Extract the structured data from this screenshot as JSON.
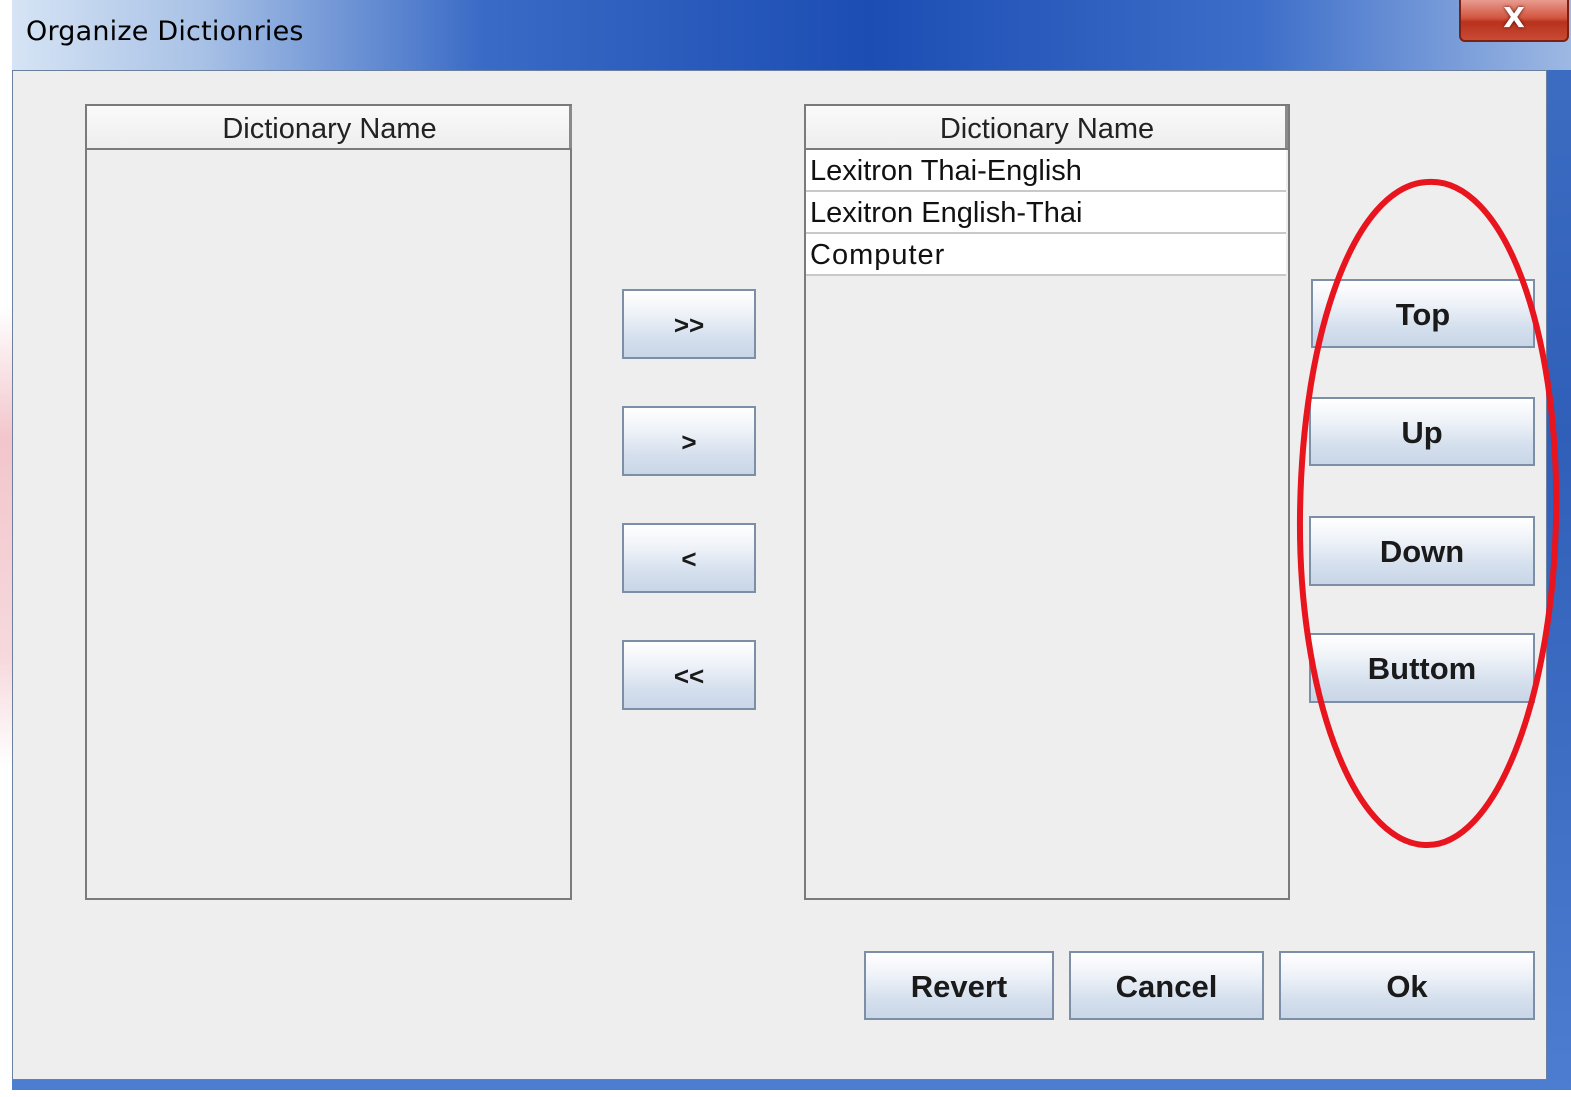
{
  "window": {
    "title": "Organize Dictionries",
    "close_label": "X"
  },
  "available_list": {
    "header": "Dictionary Name",
    "items": []
  },
  "selected_list": {
    "header": "Dictionary Name",
    "items": [
      {
        "label": "Lexitron Thai-English"
      },
      {
        "label": "Lexitron English-Thai"
      },
      {
        "label": "Computer"
      }
    ]
  },
  "transfer_buttons": {
    "add_all": ">>",
    "add_one": ">",
    "remove_one": "<",
    "remove_all": "<<"
  },
  "order_buttons": {
    "top": "Top",
    "up": "Up",
    "down": "Down",
    "bottom": "Buttom"
  },
  "footer_buttons": {
    "revert": "Revert",
    "cancel": "Cancel",
    "ok": "Ok"
  },
  "colors": {
    "annotation": "#e8141e",
    "titlebar_blue": "#1c4db3",
    "close_red": "#c94a35"
  }
}
